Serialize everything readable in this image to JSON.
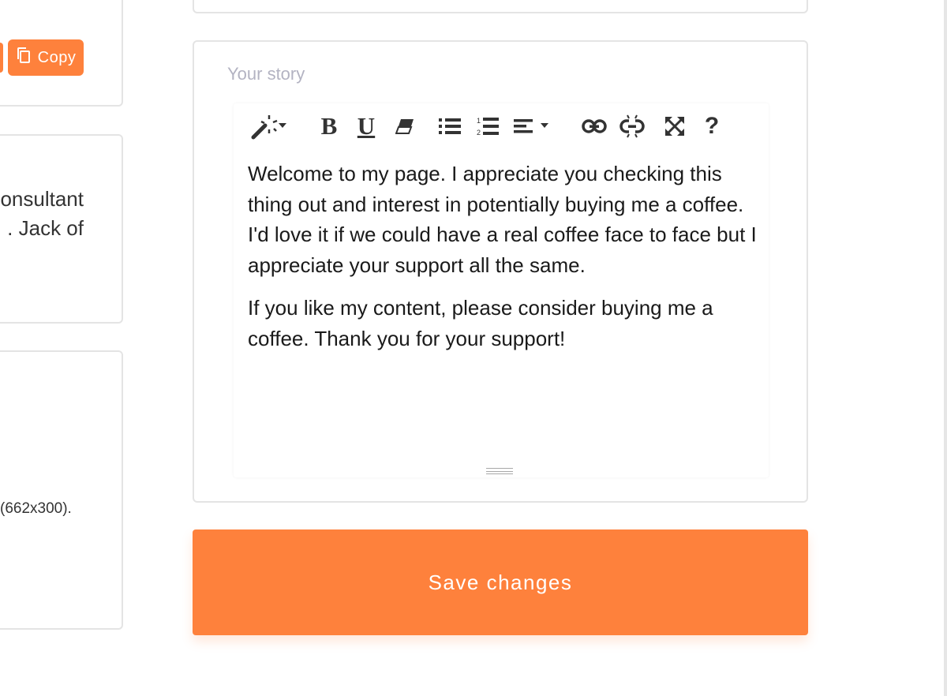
{
  "left_column": {
    "copy_button_label": "Copy",
    "bio_lines": [
      "onsultant",
      ". Jack of"
    ],
    "image_note": "(662x300)."
  },
  "story": {
    "label": "Your story",
    "paragraphs": [
      "Welcome to my page. I appreciate you checking this thing out and interest in potentially buying me a coffee. I'd love it if we could have a real coffee face to face but I appreciate your support all the same.",
      "If you like my content, please consider buying me a coffee. Thank you for your support!"
    ],
    "toolbar": {
      "bold_label": "B",
      "underline_label": "U",
      "help_label": "?",
      "icons": [
        "magic-wand-icon",
        "bold-icon",
        "underline-icon",
        "eraser-icon",
        "unordered-list-icon",
        "ordered-list-icon",
        "align-icon",
        "link-icon",
        "unlink-icon",
        "fullscreen-icon",
        "help-icon"
      ]
    }
  },
  "save_button_label": "Save changes",
  "colors": {
    "accent": "#fe813c",
    "card_border": "#e4e4e4",
    "placeholder": "#b3b3c2"
  }
}
